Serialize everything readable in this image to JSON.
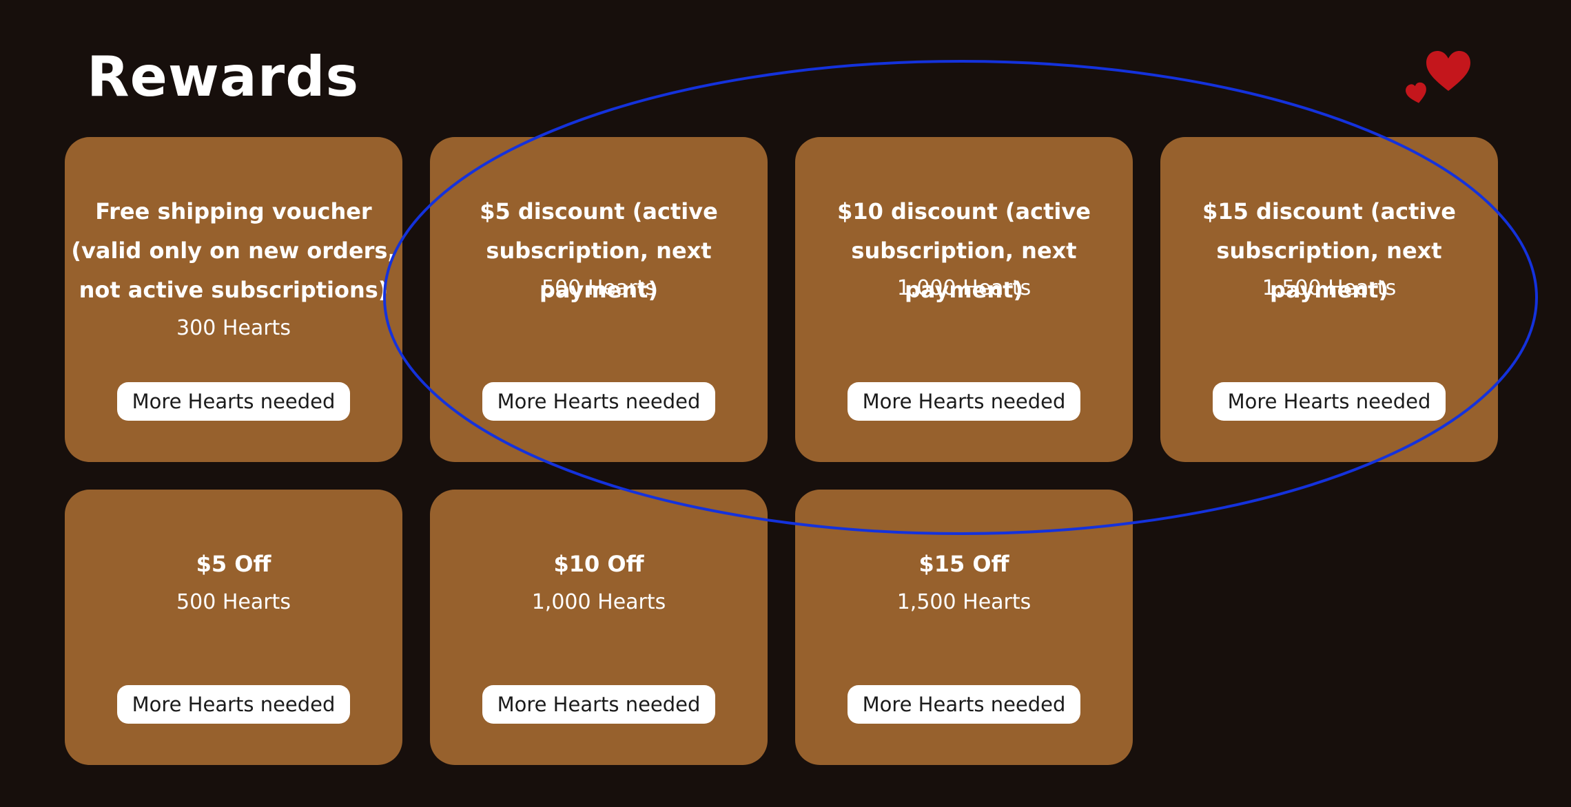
{
  "page": {
    "title": "Rewards"
  },
  "colors": {
    "background": "#170f0c",
    "card": "#97612d",
    "button_bg": "#ffffff",
    "heart": "#c4161c",
    "highlight": "#1432dc"
  },
  "icons": {
    "logo": "hearts-icon"
  },
  "rewards": [
    {
      "title": "Free shipping voucher (valid only on new orders, not active subscriptions)",
      "cost": "300 Hearts",
      "button": "More Hearts needed"
    },
    {
      "title": "$5 discount (active subscription, next payment)",
      "cost": "500 Hearts",
      "button": "More Hearts needed"
    },
    {
      "title": "$10 discount (active subscription, next payment)",
      "cost": "1,000 Hearts",
      "button": "More Hearts needed"
    },
    {
      "title": "$15 discount (active subscription, next payment)",
      "cost": "1,500 Hearts",
      "button": "More Hearts needed"
    },
    {
      "title": "$5 Off",
      "cost": "500 Hearts",
      "button": "More Hearts needed"
    },
    {
      "title": "$10 Off",
      "cost": "1,000 Hearts",
      "button": "More Hearts needed"
    },
    {
      "title": "$15 Off",
      "cost": "1,500 Hearts",
      "button": "More Hearts needed"
    }
  ]
}
